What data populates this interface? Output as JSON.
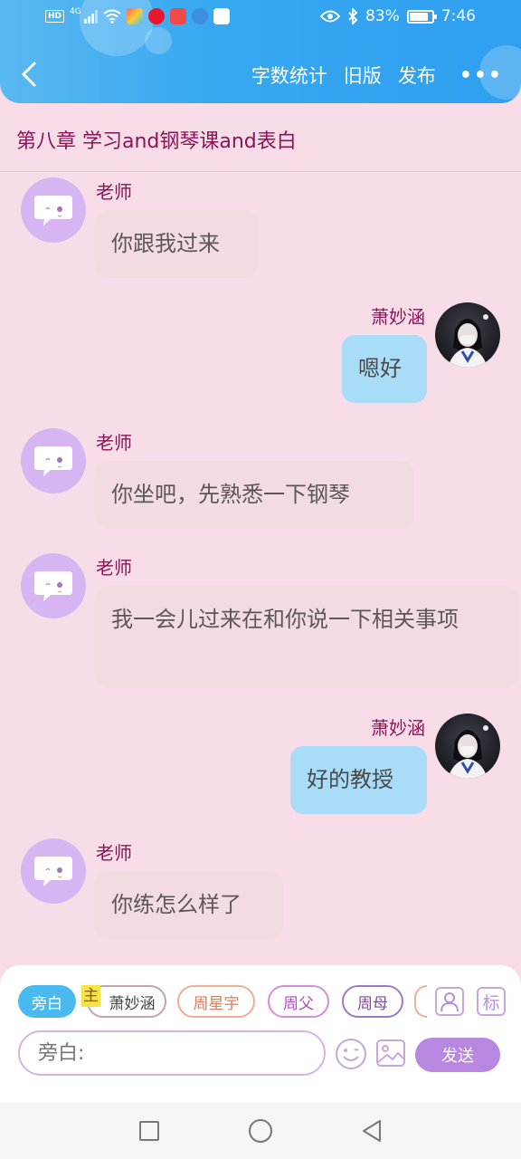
{
  "status_bar": {
    "network_badge": "HD",
    "network_type": "4G",
    "battery": "83%",
    "time": "7:46",
    "battery_level": 0.83
  },
  "nav": {
    "actions": [
      "字数统计",
      "旧版",
      "发布"
    ],
    "more": "•••"
  },
  "chapter_title": "第八章  学习and钢琴课and表白",
  "messages": [
    {
      "side": "left",
      "name": "老师",
      "text": "你跟我过来"
    },
    {
      "side": "right",
      "name": "萧妙涵",
      "text": "嗯好"
    },
    {
      "side": "left",
      "name": "老师",
      "text": "你坐吧，先熟悉一下钢琴"
    },
    {
      "side": "left",
      "name": "老师",
      "text": "我一会儿过来在和你说一下相关事项"
    },
    {
      "side": "right",
      "name": "萧妙涵",
      "text": "好的教授"
    },
    {
      "side": "left",
      "name": "老师",
      "text": "你练怎么样了"
    }
  ],
  "characters": {
    "narrator": "旁白",
    "main_tag": "主",
    "main": "萧妙涵",
    "others": [
      "周星宇",
      "周父",
      "周母"
    ],
    "tag_button": "标"
  },
  "composer": {
    "placeholder": "旁白:",
    "send_label": "发送"
  },
  "colors": {
    "header_blue": "#37a8f1",
    "background_pink": "#f8dde8",
    "accent_purple": "#b887e0",
    "name_color": "#8a1456"
  }
}
